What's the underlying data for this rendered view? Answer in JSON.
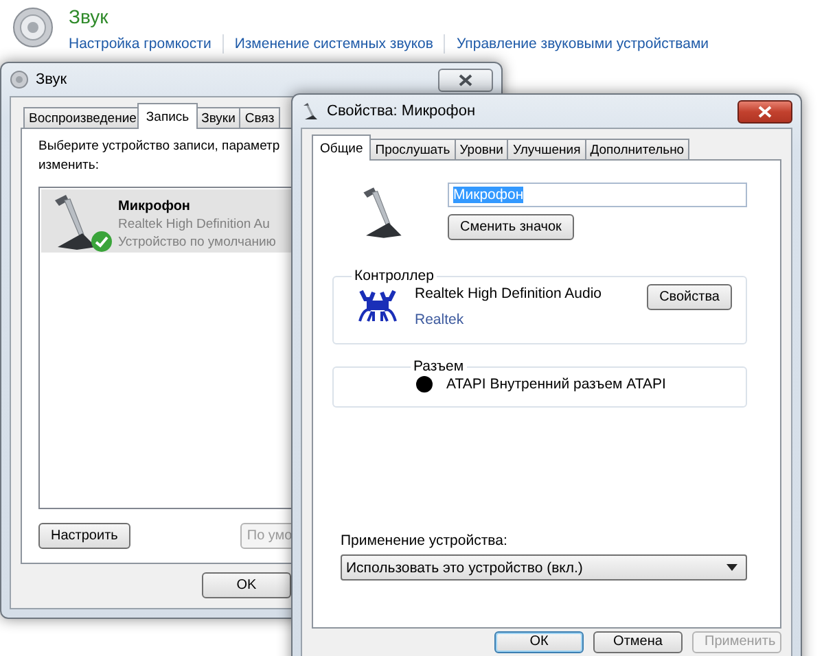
{
  "header": {
    "title": "Звук",
    "links": [
      "Настройка громкости",
      "Изменение системных звуков",
      "Управление звуковыми устройствами"
    ]
  },
  "sound_window": {
    "title": "Звук",
    "tabs": [
      {
        "label": "Воспроизведение",
        "selected": false
      },
      {
        "label": "Запись",
        "selected": true
      },
      {
        "label": "Звуки",
        "selected": false
      },
      {
        "label": "Связ",
        "selected": false
      }
    ],
    "instruction": [
      "Выберите устройство записи, параметр",
      "изменить:"
    ],
    "devices": [
      {
        "name": "Микрофон",
        "driver": "Realtek High Definition Au",
        "status": "Устройство по умолчанию",
        "default": true,
        "selected": true
      }
    ],
    "buttons": [
      {
        "label": "Настроить",
        "disabled": false
      },
      {
        "label": "По умо",
        "disabled": true
      }
    ],
    "ok_button": "OK"
  },
  "properties_window": {
    "title": "Свойства: Микрофон",
    "tabs": [
      {
        "label": "Общие",
        "selected": true
      },
      {
        "label": "Прослушать",
        "selected": false
      },
      {
        "label": "Уровни",
        "selected": false
      },
      {
        "label": "Улучшения",
        "selected": false
      },
      {
        "label": "Дополнительно",
        "selected": false
      }
    ],
    "name_field": {
      "value": "Микрофон",
      "text_selected": true
    },
    "change_icon_button": "Сменить значок",
    "controller": {
      "label": "Контроллер",
      "name": "Realtek High Definition Audio",
      "vendor_link": "Realtek",
      "button": "Свойства"
    },
    "jack": {
      "label": "Разъем",
      "color": "#000000",
      "text": "ATAPI Внутренний разъем ATAPI"
    },
    "usage": {
      "label": "Применение устройства:",
      "value": "Использовать это устройство (вкл.)"
    },
    "buttons": [
      {
        "label": "ОК",
        "disabled": false,
        "default": true
      },
      {
        "label": "Отмена",
        "disabled": false,
        "default": false
      },
      {
        "label": "Применить",
        "disabled": true,
        "default": false
      }
    ]
  }
}
